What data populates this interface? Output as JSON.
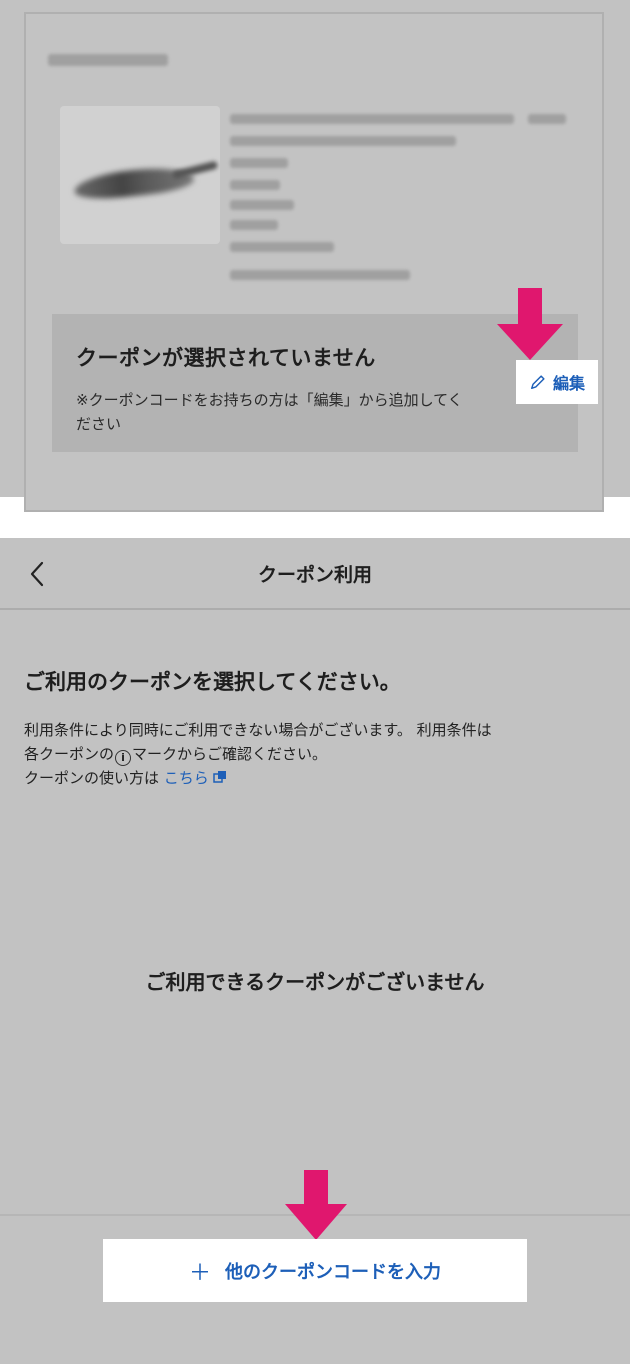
{
  "order_card": {
    "coupon_title": "クーポンが選択されていません",
    "coupon_note": "※クーポンコードをお持ちの方は「編集」から追加してください",
    "edit_label": "編集"
  },
  "coupon_screen": {
    "header_title": "クーポン利用",
    "heading": "ご利用のクーポンを選択してください。",
    "desc_line1": "利用条件により同時にご利用できない場合がございます。 利用条件は",
    "desc_line2_pre": "各クーポンの",
    "desc_info_glyph": "i",
    "desc_line2_post": "マークからご確認ください。",
    "desc_line3": "クーポンの使い方は ",
    "howto_link": "こちら",
    "empty_message": "ご利用できるクーポンがございません",
    "add_coupon_plus": "＋",
    "add_coupon_label": "他のクーポンコードを入力"
  },
  "colors": {
    "accent_blue": "#1d5fb8",
    "arrow_pink": "#e0176e",
    "panel_gray": "#c2c2c2"
  }
}
